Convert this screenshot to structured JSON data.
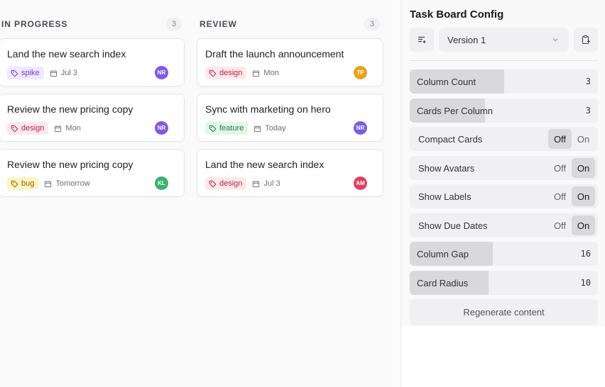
{
  "columns": [
    {
      "title": "IN PROGRESS",
      "count": "3",
      "cards": [
        {
          "title": "Land the new search index",
          "tag": "spike",
          "due": "Jul 3",
          "avatar": "NR",
          "avatar_color": "#7c5ce0"
        },
        {
          "title": "Review the new pricing copy",
          "tag": "design",
          "due": "Mon",
          "avatar": "NR",
          "avatar_color": "#7c5ce0"
        },
        {
          "title": "Review the new pricing copy",
          "tag": "bug",
          "due": "Tomorrow",
          "avatar": "KL",
          "avatar_color": "#3bb273"
        }
      ]
    },
    {
      "title": "REVIEW",
      "count": "3",
      "cards": [
        {
          "title": "Draft the launch announcement",
          "tag": "design",
          "due": "Mon",
          "avatar": "TP",
          "avatar_color": "#e8a21c"
        },
        {
          "title": "Sync with marketing on hero",
          "tag": "feature",
          "due": "Today",
          "avatar": "NR",
          "avatar_color": "#7c5ce0"
        },
        {
          "title": "Land the new search index",
          "tag": "design",
          "due": "Jul 3",
          "avatar": "AM",
          "avatar_color": "#e0405e"
        }
      ]
    }
  ],
  "panel": {
    "title": "Task Board Config",
    "version": "Version 1",
    "sliders": [
      {
        "label": "Column Count",
        "value": "3",
        "fill": 0.5
      },
      {
        "label": "Cards Per Column",
        "value": "3",
        "fill": 0.4
      },
      {
        "label": "Column Gap",
        "value": "16",
        "fill": 0.44
      },
      {
        "label": "Card Radius",
        "value": "10",
        "fill": 0.42
      }
    ],
    "toggles": [
      {
        "label": "Compact Cards",
        "off": "Off",
        "on": "On",
        "value": "Off"
      },
      {
        "label": "Show Avatars",
        "off": "Off",
        "on": "On",
        "value": "On"
      },
      {
        "label": "Show Labels",
        "off": "Off",
        "on": "On",
        "value": "On"
      },
      {
        "label": "Show Due Dates",
        "off": "Off",
        "on": "On",
        "value": "On"
      }
    ],
    "regenerate_label": "Regenerate content"
  }
}
